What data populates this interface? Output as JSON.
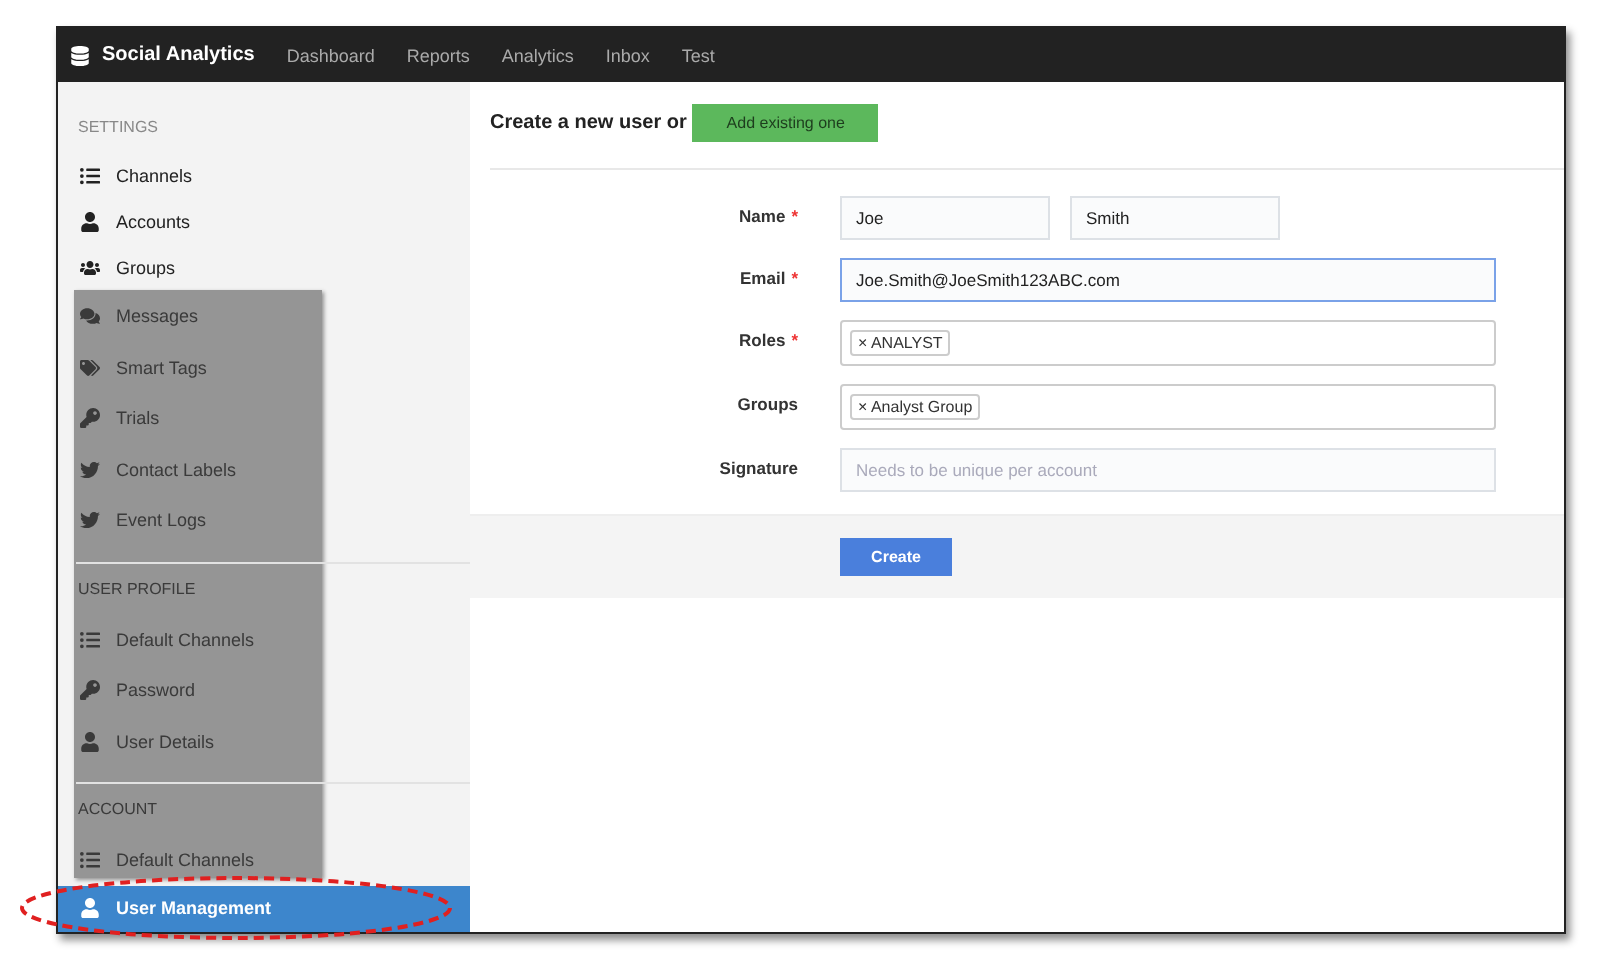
{
  "topbar": {
    "brand": "Social Analytics",
    "nav": [
      {
        "label": "Dashboard",
        "selected": false
      },
      {
        "label": "Reports",
        "selected": false
      },
      {
        "label": "Analytics",
        "selected": false
      },
      {
        "label": "Inbox",
        "selected": false
      },
      {
        "label": "Test",
        "selected": false
      }
    ]
  },
  "sidebar": [
    {
      "kind": "header",
      "label": "SETTINGS",
      "covered": false
    },
    {
      "kind": "item",
      "label": "Channels",
      "selected": false,
      "covered": false
    },
    {
      "kind": "item",
      "label": "Accounts",
      "selected": false,
      "covered": false
    },
    {
      "kind": "item",
      "label": "Groups",
      "selected": false,
      "covered": false
    },
    {
      "kind": "item",
      "label": "Messages",
      "selected": false,
      "covered": true
    },
    {
      "kind": "item",
      "label": "Smart Tags",
      "selected": false,
      "covered": true
    },
    {
      "kind": "item",
      "label": "Trials",
      "selected": false,
      "covered": true
    },
    {
      "kind": "item",
      "label": "Contact Labels",
      "selected": false,
      "covered": true
    },
    {
      "kind": "item",
      "label": "Event Logs",
      "selected": false,
      "covered": true
    },
    {
      "kind": "divider",
      "covered": true
    },
    {
      "kind": "header",
      "label": "USER PROFILE",
      "covered": true
    },
    {
      "kind": "item",
      "label": "Default Channels",
      "selected": false,
      "covered": true
    },
    {
      "kind": "item",
      "label": "Password",
      "selected": false,
      "covered": true
    },
    {
      "kind": "item",
      "label": "User Details",
      "selected": false,
      "covered": true
    },
    {
      "kind": "divider",
      "covered": true
    },
    {
      "kind": "header",
      "label": "ACCOUNT",
      "covered": true
    },
    {
      "kind": "item",
      "label": "Default Channels",
      "selected": false,
      "covered": true
    },
    {
      "kind": "item",
      "label": "User Management",
      "selected": true,
      "covered": false
    }
  ],
  "form": {
    "heading": "Create a new user or",
    "add_button": "Add existing one",
    "fields": [
      {
        "kind": "pair",
        "label": "Name",
        "required_mark": "*",
        "values": [
          "Joe",
          "Smith"
        ],
        "focused": false
      },
      {
        "kind": "text",
        "label": "Email",
        "required_mark": "*",
        "value": "Joe.Smith@JoeSmith123ABC.com",
        "focused": true
      },
      {
        "kind": "tags",
        "label": "Roles",
        "required_mark": "*",
        "tags": [
          {
            "remove": "×",
            "label": "ANALYST"
          }
        ],
        "focused": false
      },
      {
        "kind": "tags",
        "label": "Groups",
        "tags": [
          {
            "remove": "×",
            "label": "Analyst Group"
          }
        ],
        "focused": false
      },
      {
        "kind": "text",
        "label": "Signature",
        "placeholder": "Needs to be unique per account",
        "focused": false
      }
    ],
    "submit": "Create"
  }
}
